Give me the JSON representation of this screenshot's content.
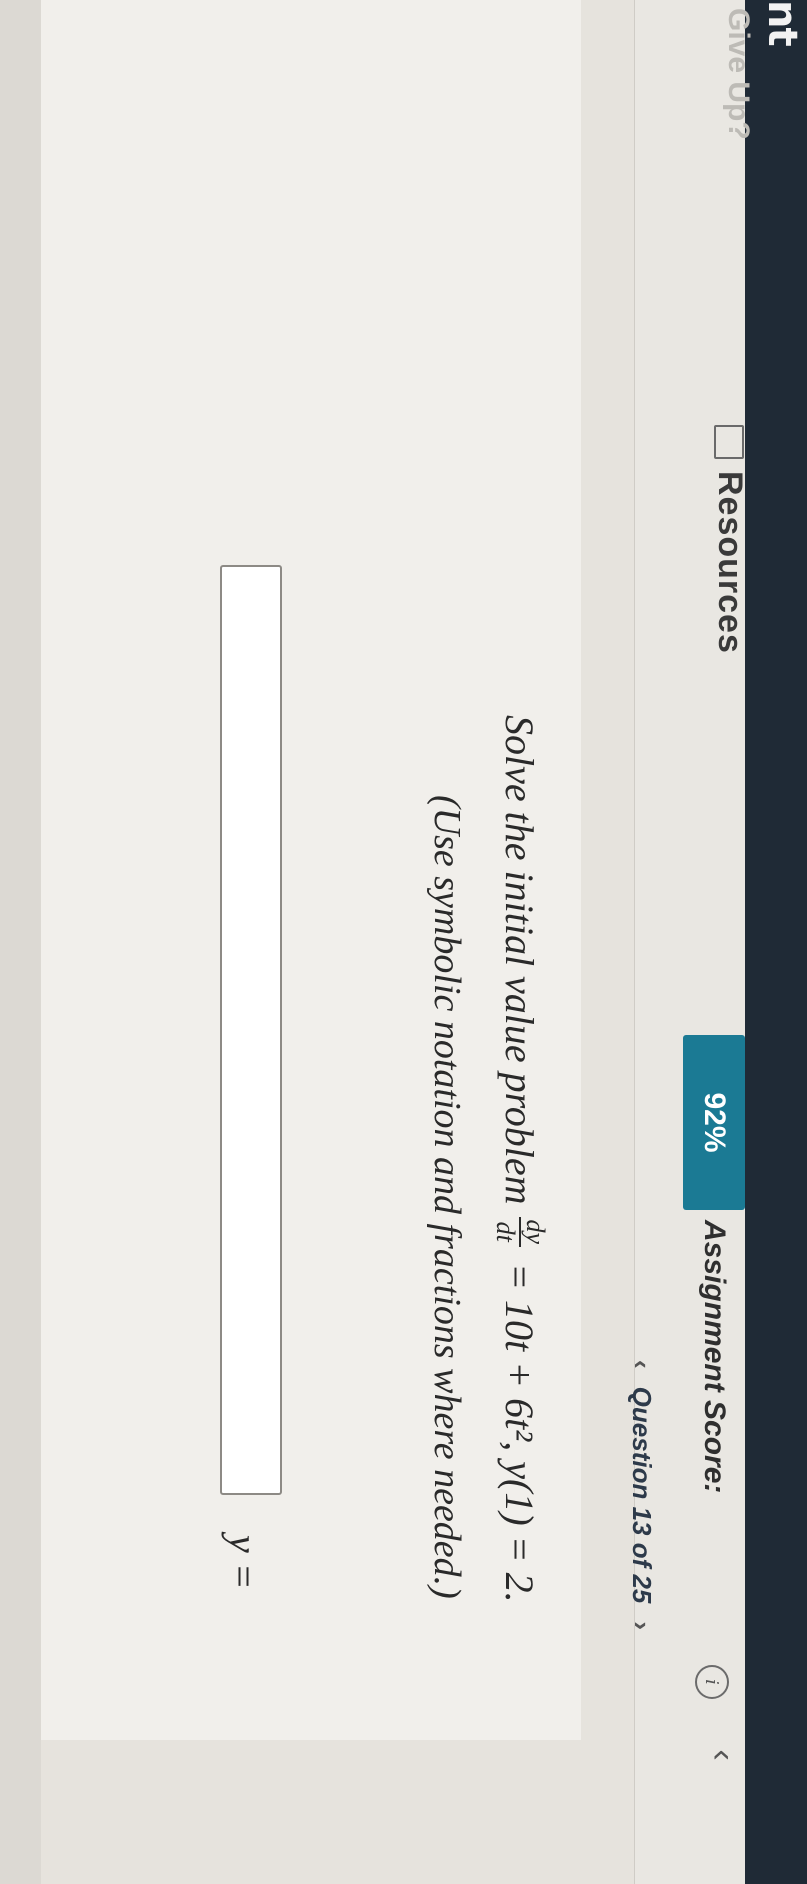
{
  "app": {
    "title_fragment": "nt"
  },
  "header": {
    "back_glyph": "‹",
    "info_glyph": "i",
    "score_label": "Assignment Score:",
    "score_value": "92%",
    "resources_label": "Resources",
    "give_up_label": "Give Up?"
  },
  "nav": {
    "prev_glyph": "‹",
    "question_label": "Question 13 of 25",
    "next_glyph": "›"
  },
  "question": {
    "prompt": "Solve the initial value problem",
    "frac_numerator": "dy",
    "frac_denominator": "dt",
    "equation_rhs": "= 10t + 6t², y(1) = 2.",
    "note": "(Use symbolic notation and fractions where needed.)",
    "answer_prefix": "y =",
    "answer_value": ""
  },
  "colors": {
    "topbar": "#1f2a36",
    "score_badge": "#1b7a94",
    "background": "#e6e3dd"
  }
}
